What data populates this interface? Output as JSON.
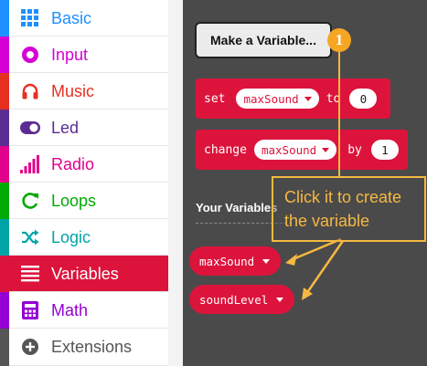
{
  "toolbox": {
    "categories": [
      {
        "label": "Basic",
        "color": "#1e90ff",
        "icon": "grid-icon"
      },
      {
        "label": "Input",
        "color": "#d400d4",
        "icon": "target-icon"
      },
      {
        "label": "Music",
        "color": "#e63022",
        "icon": "headphones-icon"
      },
      {
        "label": "Led",
        "color": "#5c2d91",
        "icon": "toggle-icon"
      },
      {
        "label": "Radio",
        "color": "#e3008c",
        "icon": "signal-bars-icon"
      },
      {
        "label": "Loops",
        "color": "#00aa00",
        "icon": "refresh-icon"
      },
      {
        "label": "Logic",
        "color": "#00a4a6",
        "icon": "shuffle-icon"
      },
      {
        "label": "Variables",
        "color": "#dc143c",
        "icon": "list-lines-icon",
        "selected": true
      },
      {
        "label": "Math",
        "color": "#9400d3",
        "icon": "calculator-icon"
      },
      {
        "label": "Extensions",
        "color": "#555555",
        "icon": "plus-circle-icon"
      }
    ]
  },
  "flyout": {
    "make_variable_label": "Make a Variable...",
    "set_block": {
      "keyword": "set",
      "variable": "maxSound",
      "to": "to",
      "value": "0"
    },
    "change_block": {
      "keyword": "change",
      "variable": "maxSound",
      "by": "by",
      "value": "1"
    },
    "your_variables_heading": "Your Variables",
    "variables": [
      "maxSound",
      "soundLevel"
    ]
  },
  "annotation": {
    "step_number": "1",
    "callout_text": "Click it to create\nthe variable",
    "color": "#f5b942"
  }
}
